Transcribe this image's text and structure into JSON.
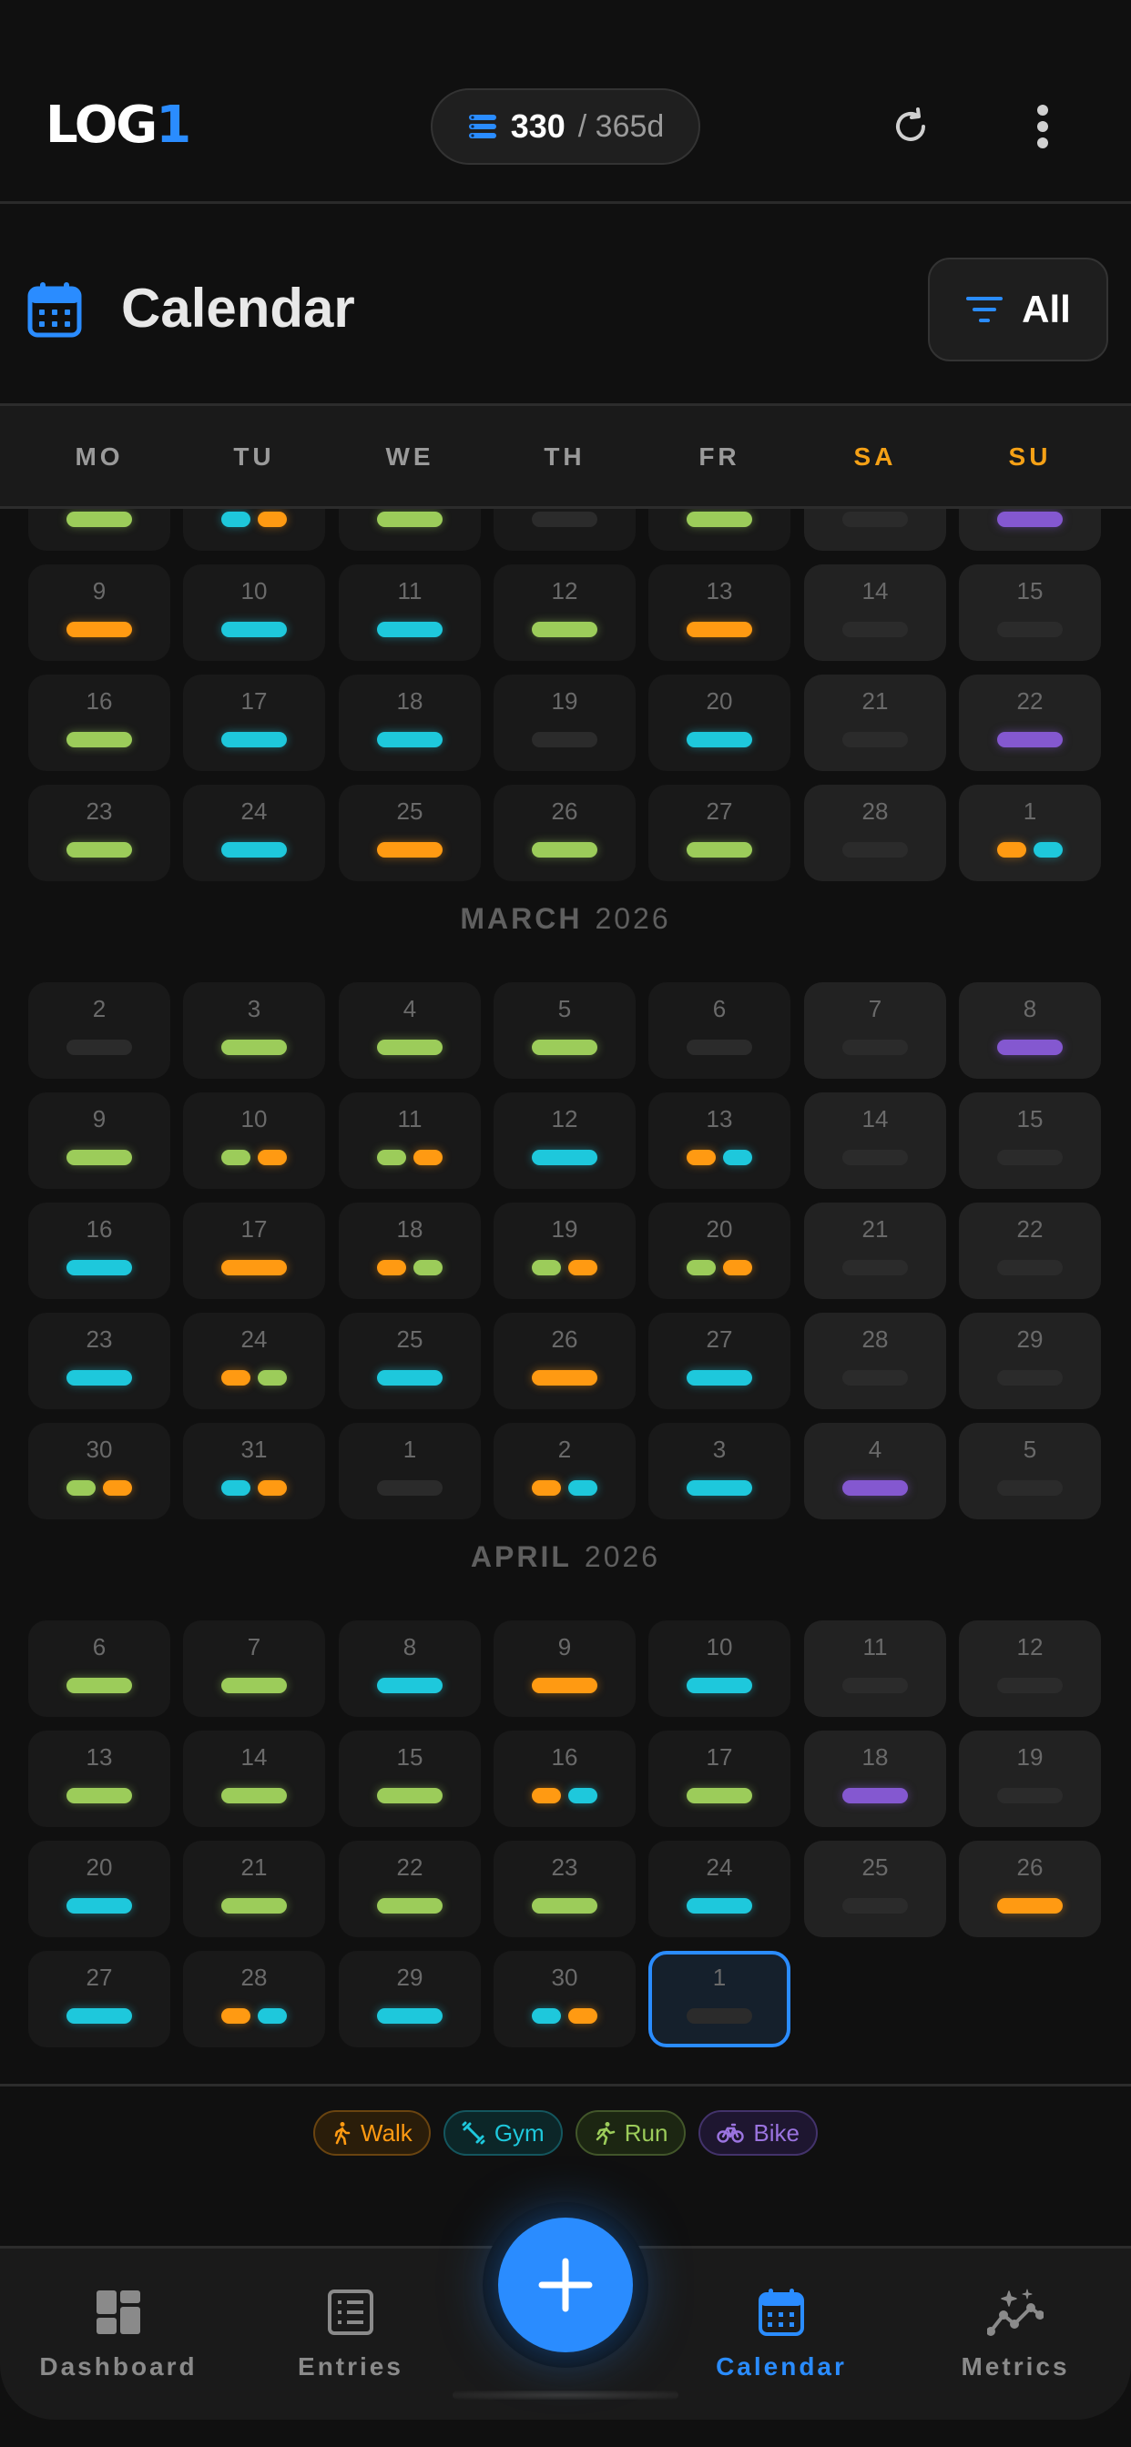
{
  "app": {
    "logo_main": "LOG",
    "logo_accent": "1",
    "streak_value": "330",
    "streak_total": "/ 365d"
  },
  "page": {
    "title": "Calendar",
    "filter_label": "All"
  },
  "weekdays": [
    "MO",
    "TU",
    "WE",
    "TH",
    "FR",
    "SA",
    "SU"
  ],
  "months": [
    {
      "name": "",
      "year": "",
      "weeks": [
        [
          [
            null,
            [
              "run"
            ]
          ],
          [
            null,
            [
              "gym",
              "walk"
            ]
          ],
          [
            null,
            [
              "run"
            ]
          ],
          [
            null,
            []
          ],
          [
            null,
            [
              "run"
            ]
          ],
          [
            null,
            []
          ],
          [
            null,
            [
              "bike"
            ]
          ]
        ],
        [
          [
            "9",
            [
              "walk"
            ]
          ],
          [
            "10",
            [
              "gym"
            ]
          ],
          [
            "11",
            [
              "gym"
            ]
          ],
          [
            "12",
            [
              "run"
            ]
          ],
          [
            "13",
            [
              "walk"
            ]
          ],
          [
            "14",
            []
          ],
          [
            "15",
            []
          ]
        ],
        [
          [
            "16",
            [
              "run"
            ]
          ],
          [
            "17",
            [
              "gym"
            ]
          ],
          [
            "18",
            [
              "gym"
            ]
          ],
          [
            "19",
            []
          ],
          [
            "20",
            [
              "gym"
            ]
          ],
          [
            "21",
            []
          ],
          [
            "22",
            [
              "bike"
            ]
          ]
        ],
        [
          [
            "23",
            [
              "run"
            ]
          ],
          [
            "24",
            [
              "gym"
            ]
          ],
          [
            "25",
            [
              "walk"
            ]
          ],
          [
            "26",
            [
              "run"
            ]
          ],
          [
            "27",
            [
              "run"
            ]
          ],
          [
            "28",
            []
          ],
          [
            "1",
            [
              "walk",
              "gym"
            ]
          ]
        ]
      ]
    },
    {
      "name": "MARCH",
      "year": "2026",
      "weeks": [
        [
          [
            "2",
            []
          ],
          [
            "3",
            [
              "run"
            ]
          ],
          [
            "4",
            [
              "run"
            ]
          ],
          [
            "5",
            [
              "run"
            ]
          ],
          [
            "6",
            []
          ],
          [
            "7",
            []
          ],
          [
            "8",
            [
              "bike"
            ]
          ]
        ],
        [
          [
            "9",
            [
              "run"
            ]
          ],
          [
            "10",
            [
              "run",
              "walk"
            ]
          ],
          [
            "11",
            [
              "run",
              "walk"
            ]
          ],
          [
            "12",
            [
              "gym"
            ]
          ],
          [
            "13",
            [
              "walk",
              "gym"
            ]
          ],
          [
            "14",
            []
          ],
          [
            "15",
            []
          ]
        ],
        [
          [
            "16",
            [
              "gym"
            ]
          ],
          [
            "17",
            [
              "walk"
            ]
          ],
          [
            "18",
            [
              "walk",
              "run"
            ]
          ],
          [
            "19",
            [
              "run",
              "walk"
            ]
          ],
          [
            "20",
            [
              "run",
              "walk"
            ]
          ],
          [
            "21",
            []
          ],
          [
            "22",
            []
          ]
        ],
        [
          [
            "23",
            [
              "gym"
            ]
          ],
          [
            "24",
            [
              "walk",
              "run"
            ]
          ],
          [
            "25",
            [
              "gym"
            ]
          ],
          [
            "26",
            [
              "walk"
            ]
          ],
          [
            "27",
            [
              "gym"
            ]
          ],
          [
            "28",
            []
          ],
          [
            "29",
            []
          ]
        ],
        [
          [
            "30",
            [
              "run",
              "walk"
            ]
          ],
          [
            "31",
            [
              "gym",
              "walk"
            ]
          ],
          [
            "1",
            []
          ],
          [
            "2",
            [
              "walk",
              "gym"
            ]
          ],
          [
            "3",
            [
              "gym"
            ]
          ],
          [
            "4",
            [
              "bike"
            ]
          ],
          [
            "5",
            []
          ]
        ]
      ]
    },
    {
      "name": "APRIL",
      "year": "2026",
      "weeks": [
        [
          [
            "6",
            [
              "run"
            ]
          ],
          [
            "7",
            [
              "run"
            ]
          ],
          [
            "8",
            [
              "gym"
            ]
          ],
          [
            "9",
            [
              "walk"
            ]
          ],
          [
            "10",
            [
              "gym"
            ]
          ],
          [
            "11",
            []
          ],
          [
            "12",
            []
          ]
        ],
        [
          [
            "13",
            [
              "run"
            ]
          ],
          [
            "14",
            [
              "run"
            ]
          ],
          [
            "15",
            [
              "run"
            ]
          ],
          [
            "16",
            [
              "walk",
              "gym"
            ]
          ],
          [
            "17",
            [
              "run"
            ]
          ],
          [
            "18",
            [
              "bike"
            ]
          ],
          [
            "19",
            []
          ]
        ],
        [
          [
            "20",
            [
              "gym"
            ]
          ],
          [
            "21",
            [
              "run"
            ]
          ],
          [
            "22",
            [
              "run"
            ]
          ],
          [
            "23",
            [
              "run"
            ]
          ],
          [
            "24",
            [
              "gym"
            ]
          ],
          [
            "25",
            []
          ],
          [
            "26",
            [
              "walk"
            ]
          ]
        ],
        [
          [
            "27",
            [
              "gym"
            ]
          ],
          [
            "28",
            [
              "walk",
              "gym"
            ]
          ],
          [
            "29",
            [
              "gym"
            ]
          ],
          [
            "30",
            [
              "gym",
              "walk"
            ]
          ],
          [
            "1",
            [],
            "today"
          ]
        ]
      ]
    }
  ],
  "legend": [
    {
      "key": "walk",
      "label": "Walk",
      "icon": "walk-icon"
    },
    {
      "key": "gym",
      "label": "Gym",
      "icon": "dumbbell-icon"
    },
    {
      "key": "run",
      "label": "Run",
      "icon": "run-icon"
    },
    {
      "key": "bike",
      "label": "Bike",
      "icon": "bike-icon"
    }
  ],
  "nav": {
    "dashboard": "Dashboard",
    "entries": "Entries",
    "calendar": "Calendar",
    "metrics": "Metrics"
  },
  "colors": {
    "accent": "#2a8cff",
    "walk": "#ff9a12",
    "gym": "#1ec8dc",
    "run": "#9ccc5a",
    "bike": "#8458d0",
    "weekend_label": "#f5a116"
  }
}
